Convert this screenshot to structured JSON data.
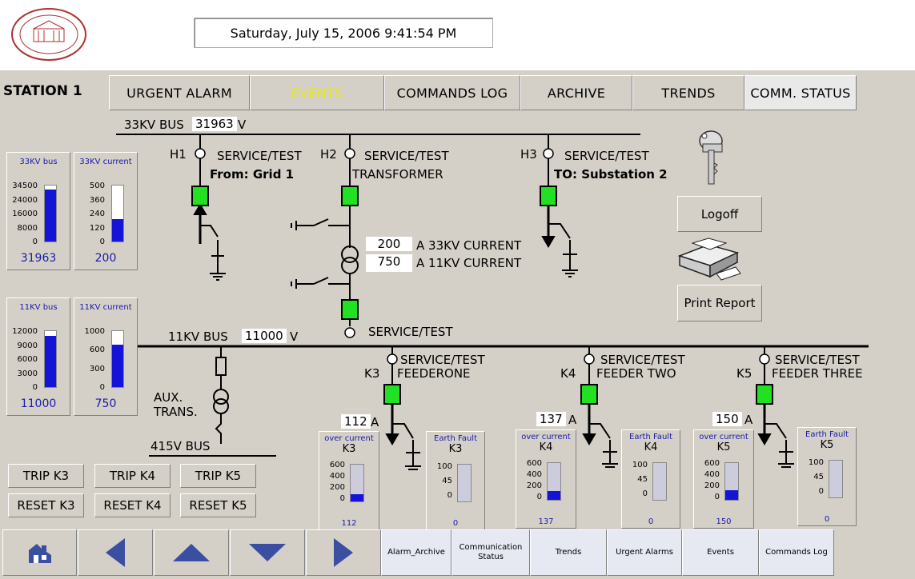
{
  "header": {
    "datetime": "Saturday, July 15, 2006 9:41:54 PM"
  },
  "station": "STATION 1",
  "nav": [
    "URGENT ALARM",
    "EVENTS",
    "COMMANDS LOG",
    "ARCHIVE",
    "TRENDS",
    "COMM. STATUS"
  ],
  "nav_active": "EVENTS",
  "bus33": {
    "label": "33KV BUS",
    "value": "31963",
    "unit": "V"
  },
  "bus11": {
    "label": "11KV BUS",
    "value": "11000",
    "unit": "V"
  },
  "bus415": "415V BUS",
  "aux_trans": [
    "AUX.",
    "TRANS."
  ],
  "h1": {
    "id": "H1",
    "status": "SERVICE/TEST",
    "desc": "From: Grid 1"
  },
  "h2": {
    "id": "H2",
    "status": "SERVICE/TEST",
    "desc": "TRANSFORMER"
  },
  "h3": {
    "id": "H3",
    "status": "SERVICE/TEST",
    "desc": "TO: Substation 2"
  },
  "trafo_status": "SERVICE/TEST",
  "currents": {
    "kv33_value": "200",
    "kv33_label": "A 33KV CURRENT",
    "kv11_value": "750",
    "kv11_label": "A 11KV CURRENT"
  },
  "feeders": [
    {
      "id": "K3",
      "status": "SERVICE/TEST",
      "name": "FEEDERONE",
      "current": "112",
      "unit": "A",
      "oc_title": "over current",
      "oc_ticks": [
        "600",
        "400",
        "200",
        "0"
      ],
      "oc_value": "112",
      "oc_level": 0.19,
      "ef_title": "Earth Fault",
      "ef_ticks": [
        "100",
        "45",
        "0"
      ],
      "ef_value": "0"
    },
    {
      "id": "K4",
      "status": "SERVICE/TEST",
      "name": "FEEDER TWO",
      "current": "137",
      "unit": "A",
      "oc_title": "over current",
      "oc_ticks": [
        "600",
        "400",
        "200",
        "0"
      ],
      "oc_value": "137",
      "oc_level": 0.23,
      "ef_title": "Earth Fault",
      "ef_ticks": [
        "100",
        "45",
        "0"
      ],
      "ef_value": "0"
    },
    {
      "id": "K5",
      "status": "SERVICE/TEST",
      "name": "FEEDER THREE",
      "current": "150",
      "unit": "A",
      "oc_title": "over current",
      "oc_ticks": [
        "600",
        "400",
        "200",
        "0"
      ],
      "oc_value": "150",
      "oc_level": 0.25,
      "ef_title": "Earth Fault",
      "ef_ticks": [
        "100",
        "45",
        "0"
      ],
      "ef_value": "0"
    }
  ],
  "gauges": [
    {
      "title": "33KV bus",
      "ticks": [
        "34500",
        "24000",
        "16000",
        "8000",
        "0"
      ],
      "value": "31963",
      "level": 0.93
    },
    {
      "title": "33KV current",
      "ticks": [
        "500",
        "360",
        "240",
        "120",
        "0"
      ],
      "value": "200",
      "level": 0.4
    },
    {
      "title": "11KV bus",
      "ticks": [
        "12000",
        "9000",
        "6000",
        "3000",
        "0"
      ],
      "value": "11000",
      "level": 0.92
    },
    {
      "title": "11KV current",
      "ticks": [
        "1000",
        "600",
        "300",
        "0"
      ],
      "value": "750",
      "level": 0.75
    }
  ],
  "trip_buttons": [
    "TRIP K3",
    "TRIP K4",
    "TRIP K5"
  ],
  "reset_buttons": [
    "RESET K3",
    "RESET K4",
    "RESET K5"
  ],
  "side": {
    "logoff": "Logoff",
    "print": "Print Report"
  },
  "bottom": [
    "Alarm_Archive",
    "Communication Status",
    "Trends",
    "Urgent Alarms",
    "Events",
    "Commands Log"
  ],
  "colors": {
    "panel": "#d4d0c8",
    "breaker": "#22e022",
    "gauge_fill": "#1414d8",
    "active_tab": "#e6e61f"
  }
}
